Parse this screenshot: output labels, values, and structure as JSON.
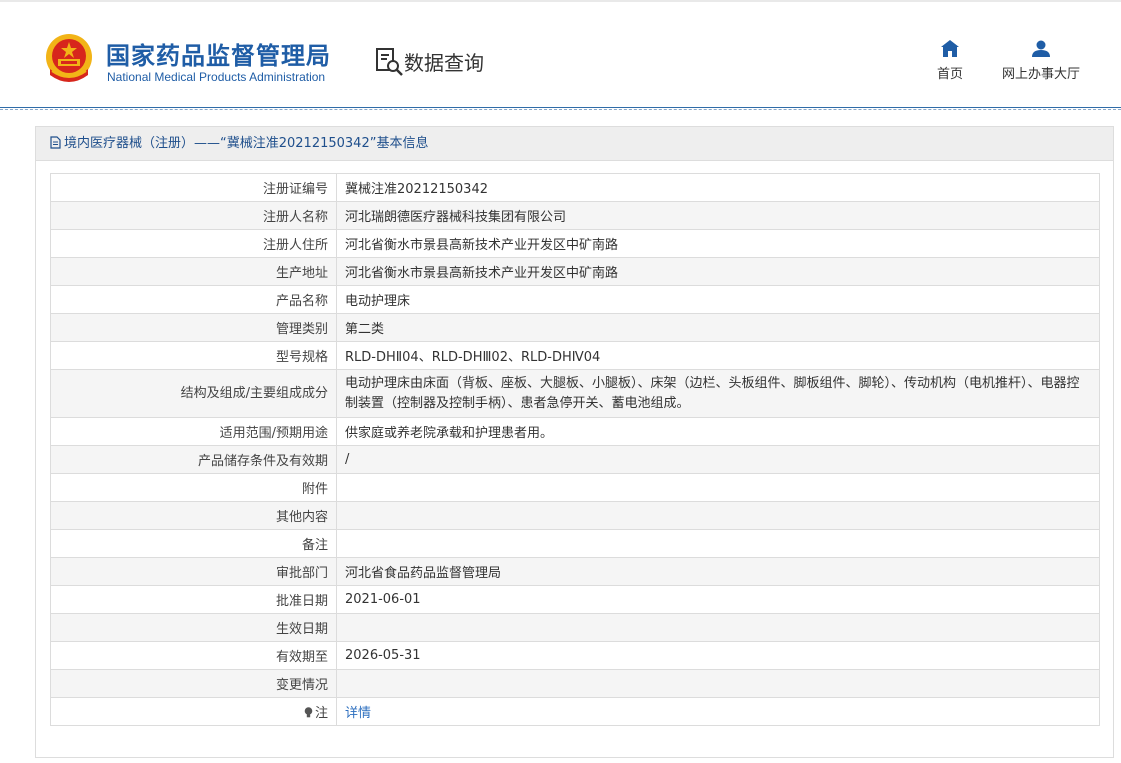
{
  "header": {
    "logo_cn": "国家药品监督管理局",
    "logo_en": "National Medical Products Administration",
    "query_label": "数据查询",
    "nav": [
      {
        "label": "首页",
        "icon": "home-icon"
      },
      {
        "label": "网上办事大厅",
        "icon": "user-icon"
      }
    ]
  },
  "panel": {
    "title": "境内医疗器械（注册）——“冀械注准20212150342”基本信息"
  },
  "rows": [
    {
      "key": "注册证编号",
      "value": "冀械注准20212150342"
    },
    {
      "key": "注册人名称",
      "value": "河北瑞朗德医疗器械科技集团有限公司"
    },
    {
      "key": "注册人住所",
      "value": "河北省衡水市景县高新技术产业开发区中矿南路"
    },
    {
      "key": "生产地址",
      "value": "河北省衡水市景县高新技术产业开发区中矿南路"
    },
    {
      "key": "产品名称",
      "value": "电动护理床"
    },
    {
      "key": "管理类别",
      "value": "第二类"
    },
    {
      "key": "型号规格",
      "value": "RLD-DHⅡ04、RLD-DHⅢ02、RLD-DHⅣ04"
    },
    {
      "key": "结构及组成/主要组成成分",
      "value": "电动护理床由床面（背板、座板、大腿板、小腿板）、床架（边栏、头板组件、脚板组件、脚轮）、传动机构（电机推杆）、电器控制装置（控制器及控制手柄）、患者急停开关、蓄电池组成。"
    },
    {
      "key": "适用范围/预期用途",
      "value": "供家庭或养老院承载和护理患者用。"
    },
    {
      "key": "产品储存条件及有效期",
      "value": "/"
    },
    {
      "key": "附件",
      "value": ""
    },
    {
      "key": "其他内容",
      "value": ""
    },
    {
      "key": "备注",
      "value": ""
    },
    {
      "key": "审批部门",
      "value": "河北省食品药品监督管理局"
    },
    {
      "key": "批准日期",
      "value": "2021-06-01"
    },
    {
      "key": "生效日期",
      "value": ""
    },
    {
      "key": "有效期至",
      "value": "2026-05-31"
    },
    {
      "key": "变更情况",
      "value": ""
    }
  ],
  "note_row": {
    "key": "注",
    "value": "详情",
    "icon": "lightbulb-icon"
  },
  "colors": {
    "brand_blue": "#1f5da6",
    "link_blue": "#2d6fbf",
    "emblem_red": "#d7261c",
    "emblem_gold": "#f2b417"
  }
}
